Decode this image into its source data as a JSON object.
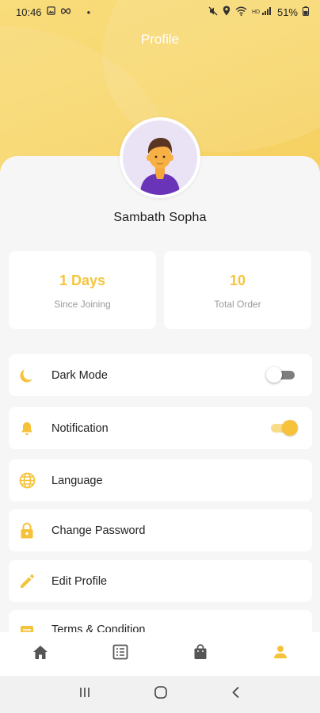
{
  "status_bar": {
    "time": "10:46",
    "battery": "51%",
    "left_icons": [
      "gallery-icon",
      "infinity-icon",
      "dot-icon"
    ],
    "right_icons": [
      "mute-icon",
      "location-icon",
      "wifi-icon",
      "signal-icon",
      "battery-icon"
    ]
  },
  "header": {
    "title": "Profile"
  },
  "profile": {
    "name": "Sambath Sopha"
  },
  "stats": [
    {
      "value": "1 Days",
      "label": "Since Joining"
    },
    {
      "value": "10",
      "label": "Total Order"
    }
  ],
  "menu": [
    {
      "label": "Dark Mode",
      "icon": "moon-icon",
      "toggle": "off"
    },
    {
      "label": "Notification",
      "icon": "bell-icon",
      "toggle": "on"
    },
    {
      "label": "Language",
      "icon": "globe-icon"
    },
    {
      "label": "Change Password",
      "icon": "lock-icon"
    },
    {
      "label": "Edit Profile",
      "icon": "pencil-icon"
    },
    {
      "label": "Terms & Condition",
      "icon": "document-icon"
    }
  ],
  "bottom_nav": [
    {
      "icon": "home-icon",
      "active": false
    },
    {
      "icon": "list-icon",
      "active": false
    },
    {
      "icon": "shopping-bag-icon",
      "active": false
    },
    {
      "icon": "person-icon",
      "active": true
    }
  ],
  "colors": {
    "accent": "#F5C23A",
    "header_gradient": "#F8D870",
    "icon_inactive": "#555555",
    "background": "#F6F6F6"
  }
}
